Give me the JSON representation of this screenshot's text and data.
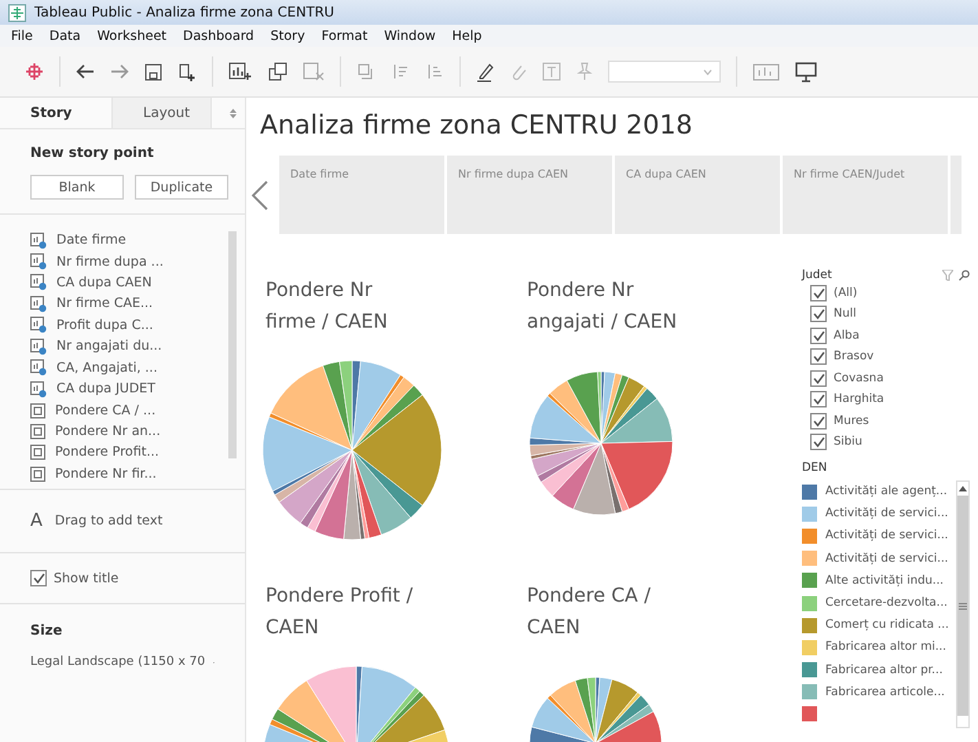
{
  "window": {
    "title": "Tableau Public - Analiza firme zona CENTRU"
  },
  "menu": [
    "File",
    "Data",
    "Worksheet",
    "Dashboard",
    "Story",
    "Format",
    "Window",
    "Help"
  ],
  "side_tabs": [
    {
      "label": "Story",
      "selected": true
    },
    {
      "label": "Layout",
      "selected": false
    }
  ],
  "new_story_point": {
    "heading": "New story point",
    "buttons": [
      "Blank",
      "Duplicate"
    ]
  },
  "sheets": [
    {
      "label": "Date firme",
      "kind": "worksheet"
    },
    {
      "label": "Nr firme dupa ...",
      "kind": "worksheet"
    },
    {
      "label": "CA dupa CAEN",
      "kind": "worksheet"
    },
    {
      "label": "Nr firme CAE...",
      "kind": "worksheet"
    },
    {
      "label": "Profit dupa C...",
      "kind": "worksheet"
    },
    {
      "label": "Nr angajati du...",
      "kind": "worksheet"
    },
    {
      "label": "CA, Angajati, ...",
      "kind": "worksheet"
    },
    {
      "label": "CA dupa JUDET",
      "kind": "worksheet"
    },
    {
      "label": "Pondere CA / ...",
      "kind": "dashboard"
    },
    {
      "label": "Pondere Nr an...",
      "kind": "dashboard"
    },
    {
      "label": "Pondere Profit...",
      "kind": "dashboard"
    },
    {
      "label": "Pondere Nr fir...",
      "kind": "dashboard"
    }
  ],
  "text_object": {
    "icon": "A",
    "label": "Drag to add text"
  },
  "show_title": {
    "label": "Show title",
    "checked": true
  },
  "size": {
    "heading": "Size",
    "value": "Legal Landscape (1150 x 70"
  },
  "story_title": "Analiza firme zona CENTRU 2018",
  "story_points": [
    "Date firme",
    "Nr firme dupa CAEN",
    "CA dupa CAEN",
    "Nr firme CAEN/Judet"
  ],
  "charts": [
    {
      "title": "Pondere Nr firme / CAEN"
    },
    {
      "title": "Pondere Nr angajati / CAEN"
    },
    {
      "title": "Pondere Profit / CAEN"
    },
    {
      "title": "Pondere CA / CAEN"
    }
  ],
  "judet_filter": {
    "title": "Judet",
    "items": [
      {
        "label": "(All)",
        "checked": true
      },
      {
        "label": "Null",
        "checked": true
      },
      {
        "label": "Alba",
        "checked": true
      },
      {
        "label": "Brasov",
        "checked": true
      },
      {
        "label": "Covasna",
        "checked": true
      },
      {
        "label": "Harghita",
        "checked": true
      },
      {
        "label": "Mures",
        "checked": true
      },
      {
        "label": "Sibiu",
        "checked": true
      }
    ]
  },
  "den_legend": {
    "title": "DEN",
    "items": [
      {
        "label": "Activități ale agenț...",
        "color": "#4e79a7"
      },
      {
        "label": "Activități de servici...",
        "color": "#a0cbe8"
      },
      {
        "label": "Activități de servici...",
        "color": "#f28e2b"
      },
      {
        "label": "Activități de servici...",
        "color": "#ffbe7d"
      },
      {
        "label": "Alte activități indu...",
        "color": "#59a14f"
      },
      {
        "label": "Cercetare-dezvolta...",
        "color": "#8cd17d"
      },
      {
        "label": "Comerț cu ridicata ...",
        "color": "#b6992d"
      },
      {
        "label": "Fabricarea altor mi...",
        "color": "#f1ce63"
      },
      {
        "label": "Fabricarea altor pr...",
        "color": "#499894"
      },
      {
        "label": "Fabricarea articole...",
        "color": "#86bcb6"
      }
    ]
  }
}
